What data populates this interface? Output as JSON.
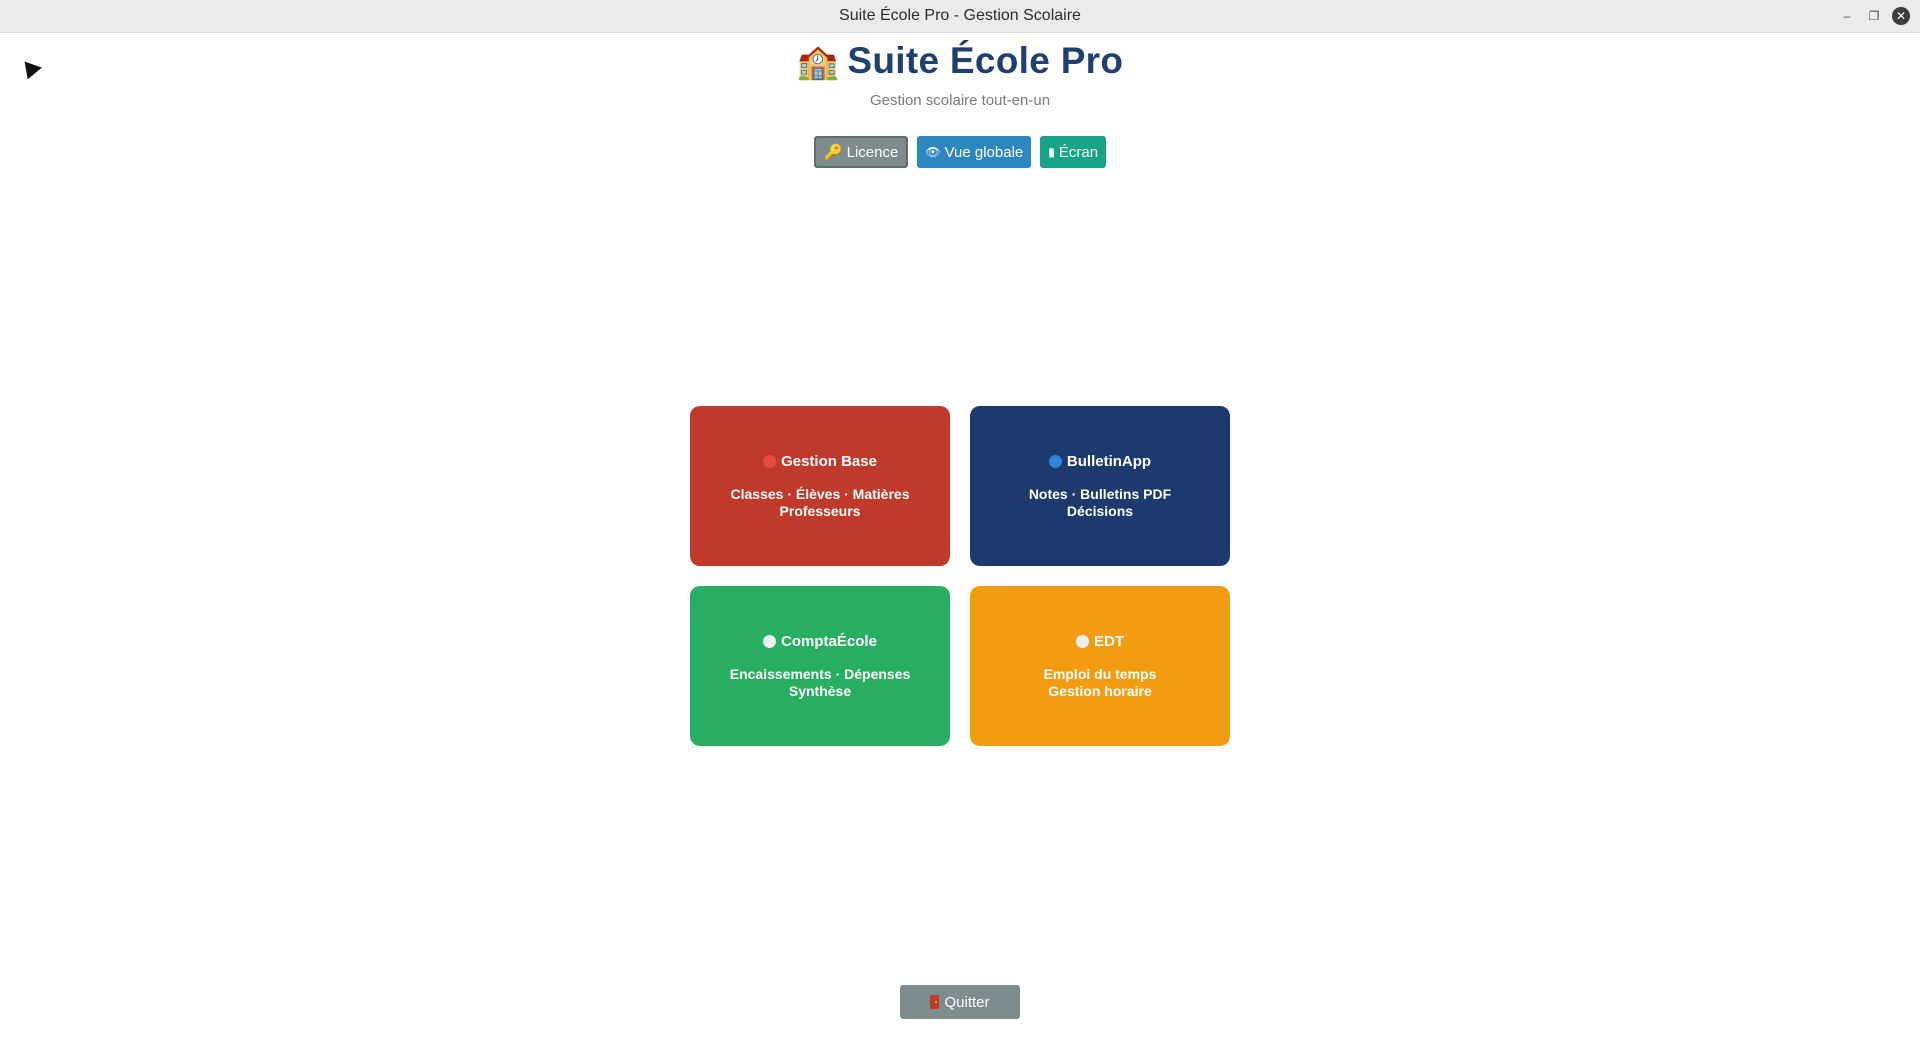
{
  "window": {
    "title": "Suite École Pro - Gestion Scolaire",
    "minimize_glyph": "–",
    "maximize_glyph": "❐",
    "close_glyph": "✕"
  },
  "header": {
    "emoji": "🏫",
    "title": "Suite École Pro",
    "subtitle": "Gestion scolaire tout-en-un"
  },
  "toolbar": {
    "licence": {
      "icon": "🔑",
      "label": "Licence"
    },
    "vue_globale": {
      "icon": "👁",
      "label": "Vue globale"
    },
    "ecran": {
      "icon": "▮",
      "label": "Écran"
    }
  },
  "modules": [
    {
      "title": "Gestion Base",
      "line1": "Classes · Élèves · Matières",
      "line2": "Professeurs",
      "color": "#c0392b",
      "dot_color": "#e74c3c"
    },
    {
      "title": "BulletinApp",
      "line1": "Notes · Bulletins PDF",
      "line2": "Décisions",
      "color": "#1c3a6e",
      "dot_color": "#2e86de"
    },
    {
      "title": "ComptaÉcole",
      "line1": "Encaissements · Dépenses",
      "line2": "Synthèse",
      "color": "#27ae60",
      "dot_color": "#ecf0f1"
    },
    {
      "title": "EDT",
      "line1": "Emploi du temps",
      "line2": "Gestion horaire",
      "color": "#f39c12",
      "dot_color": "#ecf0f1"
    }
  ],
  "footer": {
    "quit_label": "Quitter"
  }
}
